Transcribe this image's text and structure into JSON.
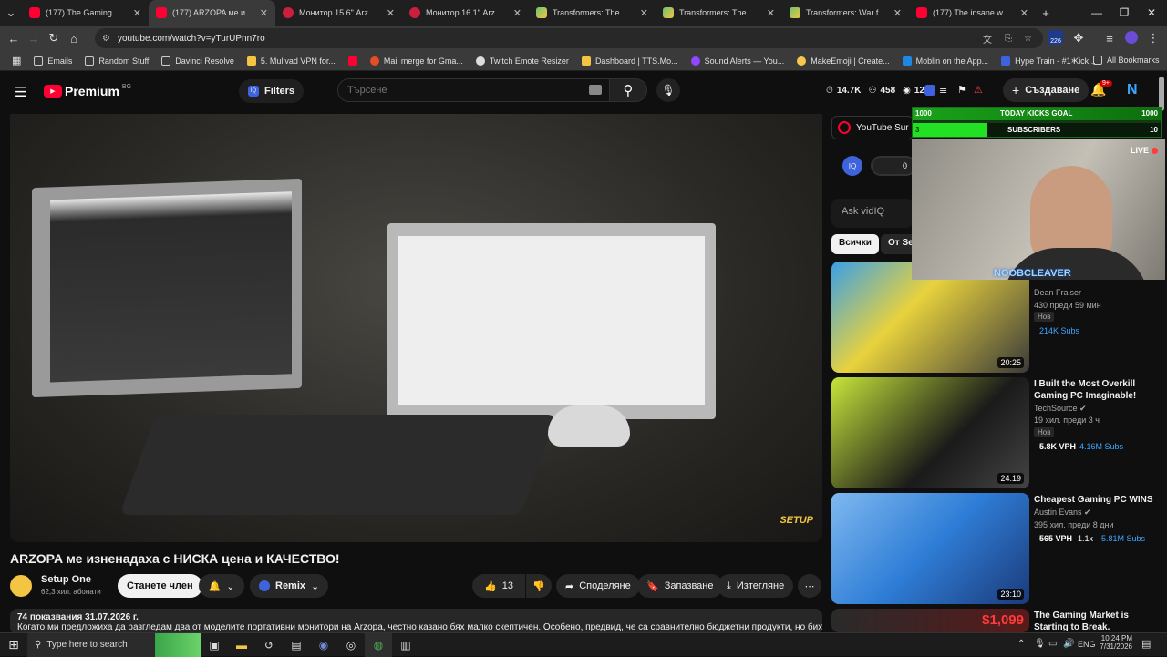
{
  "tabs": [
    {
      "title": "(177) The Gaming Market",
      "favicon": "youtube-icon"
    },
    {
      "title": "(177) ARZOPA ме изн...",
      "favicon": "youtube-icon",
      "active": true
    },
    {
      "title": "Монитор 15.6\" Arzopa A",
      "favicon": "store-icon"
    },
    {
      "title": "Монитор 16.1\" Arzopa Z",
      "favicon": "store-icon"
    },
    {
      "title": "Transformers: The Game",
      "favicon": "game-icon"
    },
    {
      "title": "Transformers: The Game",
      "favicon": "game-icon"
    },
    {
      "title": "Transformers: War for Cyb",
      "favicon": "game-icon"
    },
    {
      "title": "(177) The insane world of",
      "favicon": "youtube-icon"
    }
  ],
  "address": {
    "url": "youtube.com/watch?v=yTurUPnn7ro",
    "ext_badge": "226"
  },
  "bookmarks": [
    "Emails",
    "Random Stuff",
    "Davinci Resolve",
    "5. Mullvad VPN for...",
    "Mail merge for Gma...",
    "Twitch Emote Resizer",
    "Dashboard | TTS.Mo...",
    "Sound Alerts — You...",
    "MakeEmoji | Create...",
    "Moblin on the App...",
    "Hype Train - #1 Kick..."
  ],
  "bookmarks_all": "All Bookmarks",
  "header": {
    "logo": "Premium",
    "logo_region": "BG",
    "filters": "Filters",
    "search_placeholder": "Търсене",
    "stat_views": "14.7K",
    "stat_eyes": "458",
    "stat_count": "12",
    "create": "Създаване",
    "notif": "9+"
  },
  "video": {
    "title": "ARZOPA ме изненадаха с НИСКА цена и КАЧЕСТВО!",
    "channel": "Setup One",
    "subs": "62,3 хил. абонати",
    "join": "Станете член",
    "remix": "Remix",
    "likes": "13",
    "share": "Споделяне",
    "save": "Запазване",
    "download": "Изтегляне",
    "views_date": "74 показвания  31.07.2026 г.",
    "desc": "Когато ми предложиха да разгледам два от моделите портативни монитори на Arzopa, честно казано бях малко скептичен. Особено, предвид, че са сравнително бюджетни продукти, но бих казал"
  },
  "sidebar": {
    "premium_label": "YouTube Sur",
    "ask": "Ask vidIQ",
    "chip_all": "Всички",
    "chip_from": "От Set",
    "items": [
      {
        "channel": "Dean Fraiser",
        "meta": "430  преди 59 мин",
        "badge": "Нов",
        "subs": "214K Subs",
        "duration": "20:25"
      },
      {
        "title": "I Built the Most Overkill Gaming PC Imaginable!",
        "channel": "TechSource",
        "meta": "19 хил.  преди 3 ч",
        "badge": "Нов",
        "vph": "5.8K VPH",
        "subs": "4.16M Subs",
        "duration": "24:19"
      },
      {
        "title": "Cheapest Gaming PC WINS",
        "channel": "Austin Evans",
        "meta": "395 хил.  преди 8 дни",
        "vph": "565 VPH",
        "mult": "1.1x",
        "subs": "5.81M Subs",
        "duration": "23:10"
      },
      {
        "title": "The Gaming Market is Starting to Break.",
        "price": "$1,099"
      }
    ]
  },
  "overlay": {
    "kicks_left": "1000",
    "kicks_goal": "TODAY KICKS GOAL",
    "kicks_right": "1000",
    "subs_left": "3",
    "subs_label": "SUBSCRIBERS",
    "subs_right": "10",
    "live": "LIVE",
    "name": "NOOBCLEAVER"
  },
  "taskbar": {
    "search": "Type here to search",
    "lang": "ENG",
    "time": "10:24 PM",
    "date": "7/31/2026"
  },
  "colors": {
    "accent_red": "#ff0033",
    "green": "#1faa1f",
    "blue": "#3ea6ff"
  }
}
